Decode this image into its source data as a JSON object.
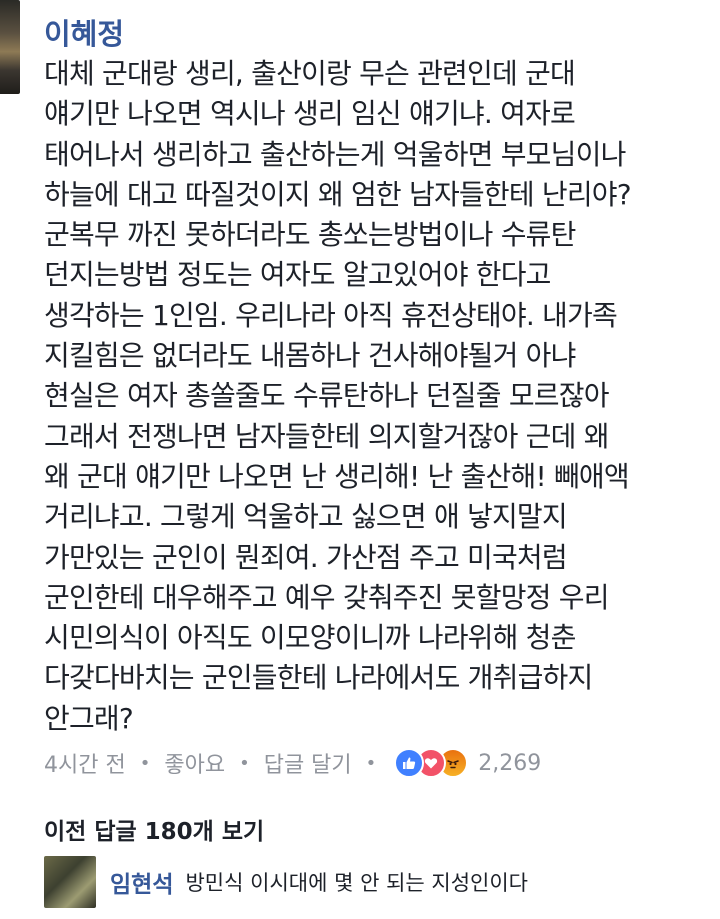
{
  "comment": {
    "author": "이혜정",
    "text": "대체 군대랑 생리, 출산이랑 무슨 관련인데 군대\n얘기만 나오면 역시나 생리 임신 얘기냐. 여자로\n태어나서 생리하고 출산하는게 억울하면 부모님이나\n하늘에 대고 따질것이지 왜 엄한 남자들한테 난리야?\n군복무 까진 못하더라도 총쏘는방법이나 수류탄\n던지는방법 정도는 여자도 알고있어야 한다고\n생각하는 1인임. 우리나라 아직 휴전상태야. 내가족\n지킬힘은 없더라도 내몸하나 건사해야될거 아냐\n현실은 여자 총쏠줄도 수류탄하나 던질줄 모르잖아\n그래서 전쟁나면 남자들한테 의지할거잖아 근데 왜\n왜 군대 얘기만 나오면 난 생리해! 난 출산해! 빼애액\n거리냐고. 그렇게 억울하고 싫으면 애 낳지말지\n가만있는 군인이 뭔죄여. 가산점 주고 미국처럼\n군인한테 대우해주고 예우 갖춰주진 못할망정 우리\n시민의식이 아직도 이모양이니까 나라위해 청춘\n다갖다바치는 군인들한테 나라에서도 개취급하지\n안그래?",
    "time": "4시간 전",
    "like_label": "좋아요",
    "reply_label": "답글 달기",
    "reaction_count": "2,269",
    "reaction_icons": [
      "like-icon",
      "love-icon",
      "angry-icon"
    ]
  },
  "replies": {
    "view_previous_label": "이전 답글 180개 보기",
    "items": [
      {
        "author": "임현석",
        "text": "방민식 이시대에 몇 안 되는 지성인이다"
      }
    ]
  },
  "colors": {
    "author_link": "#365899",
    "meta_gray": "#90949c",
    "like_blue": "#4080ff",
    "love_red": "#f25268",
    "angry_orange": "#e9710f"
  }
}
